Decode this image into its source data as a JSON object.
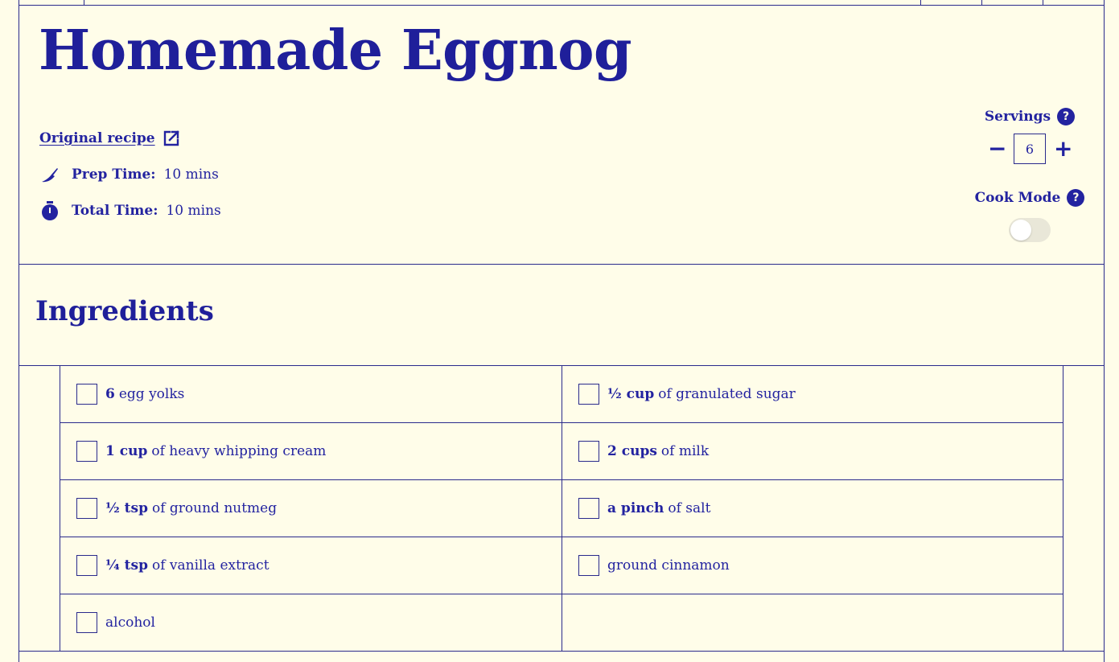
{
  "recipe": {
    "title": "Homemade Eggnog",
    "original_link": "Original recipe",
    "prep_label": "Prep Time:",
    "prep_value": "10 mins",
    "total_label": "Total Time:",
    "total_value": "10 mins"
  },
  "servings": {
    "label": "Servings",
    "value": "6",
    "minus": "−",
    "plus": "+",
    "help": "?"
  },
  "cook_mode": {
    "label": "Cook Mode",
    "help": "?",
    "enabled": false
  },
  "ingredients": {
    "title": "Ingredients",
    "rows": [
      [
        {
          "qty": "6",
          "text": "egg yolks"
        },
        {
          "qty": "½ cup",
          "text": "of granulated sugar"
        }
      ],
      [
        {
          "qty": "1 cup",
          "text": "of heavy whipping cream"
        },
        {
          "qty": "2 cups",
          "text": "of milk"
        }
      ],
      [
        {
          "qty": "½ tsp",
          "text": "of ground nutmeg"
        },
        {
          "qty": "a pinch",
          "text": "of salt"
        }
      ],
      [
        {
          "qty": "¼ tsp",
          "text": "of vanilla extract"
        },
        {
          "qty": "",
          "text": "ground cinnamon"
        }
      ],
      [
        {
          "qty": "",
          "text": "alcohol"
        },
        null
      ]
    ]
  },
  "icons": {
    "external_link": "external-link-icon",
    "prep": "knife-icon",
    "total": "stopwatch-icon",
    "help": "question-circle-icon"
  },
  "colors": {
    "ink": "#2323a0",
    "background": "#fffde9"
  }
}
